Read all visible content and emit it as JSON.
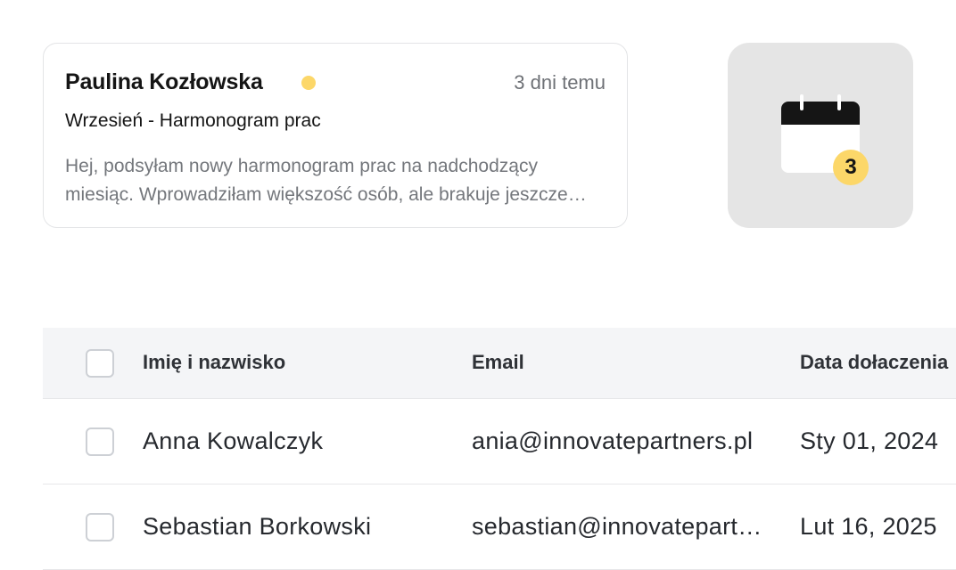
{
  "message": {
    "sender": "Paulina Kozłowska",
    "time": "3 dni temu",
    "subject": "Wrzesień - Harmonogram prac",
    "preview": "Hej, podsyłam nowy harmonogram prac na nadchodzący miesiąc. Wprowadziłam większość osób, ale brakuje jeszcze kilku zmian.",
    "unread_color": "#fcd769"
  },
  "calendar": {
    "icon": "calendar-icon",
    "badge_count": "3",
    "badge_color": "#fcd769",
    "tile_color": "#e5e5e5"
  },
  "table": {
    "columns": {
      "name": "Imię i nazwisko",
      "email": "Email",
      "date": "Data dołaczenia"
    },
    "rows": [
      {
        "name": "Anna Kowalczyk",
        "email": "ania@innovatepartners.pl",
        "date": "Sty 01, 2024"
      },
      {
        "name": "Sebastian Borkowski",
        "email": "sebastian@innovatepartners.pl",
        "date": "Lut 16, 2025"
      }
    ]
  }
}
